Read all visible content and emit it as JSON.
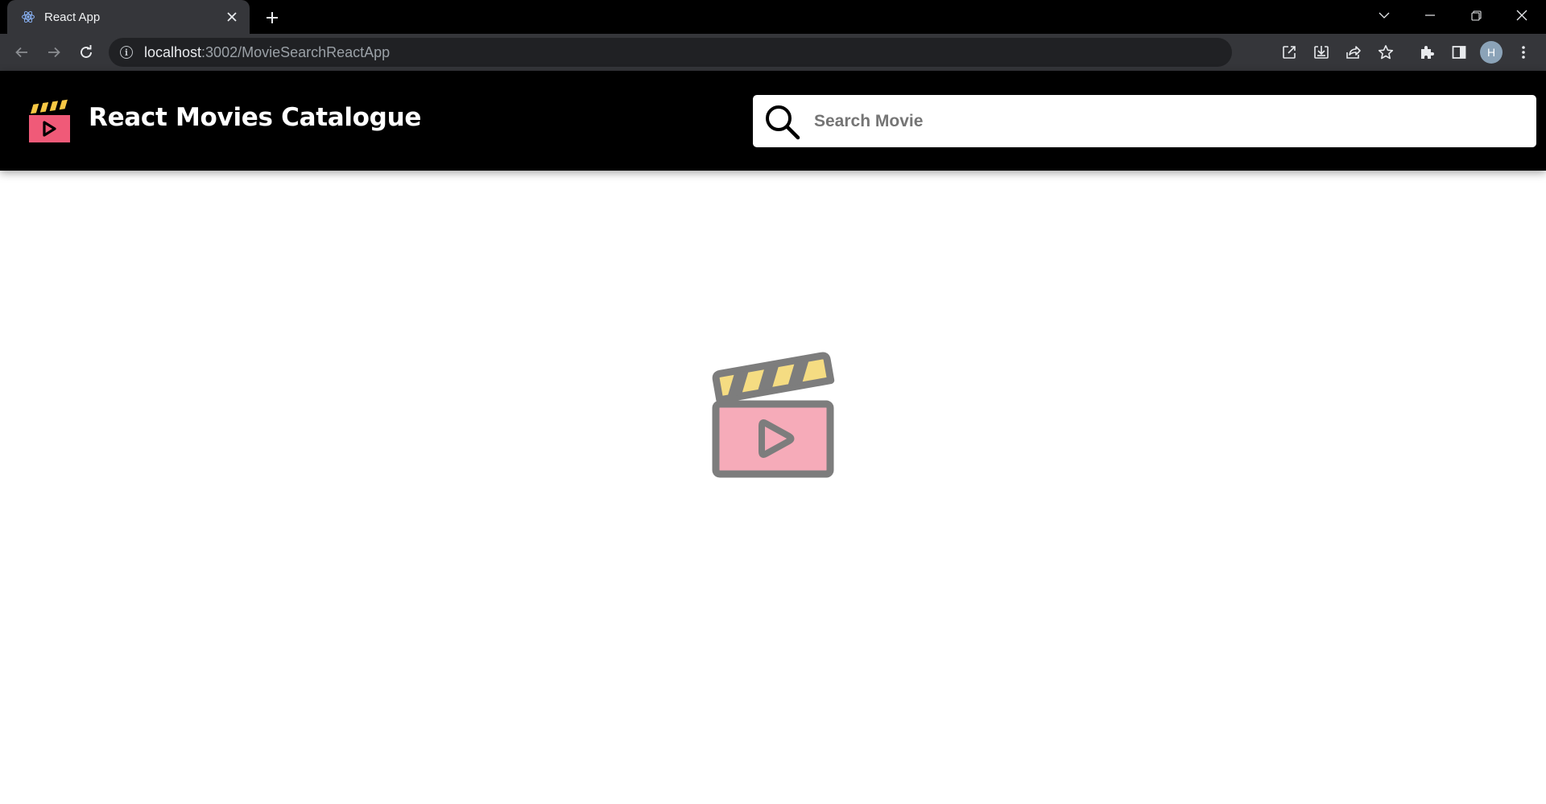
{
  "browser": {
    "tab": {
      "title": "React App",
      "favicon": "react-logo-icon"
    },
    "url": {
      "host": "localhost",
      "rest": ":3002/MovieSearchReactApp"
    },
    "profile_initial": "H"
  },
  "header": {
    "title": "React Movies Catalogue",
    "logo": "clapperboard-icon"
  },
  "search": {
    "placeholder": "Search Movie",
    "value": ""
  },
  "main": {
    "illustration": "clapperboard-icon"
  },
  "colors": {
    "header_bg": "#000000",
    "logo_clapper_stripe": "#f7c844",
    "logo_board": "#f05a78",
    "illustration_outline": "#7d7d7d",
    "illustration_stripe": "#f5dc82",
    "illustration_board": "#f6abb9"
  }
}
